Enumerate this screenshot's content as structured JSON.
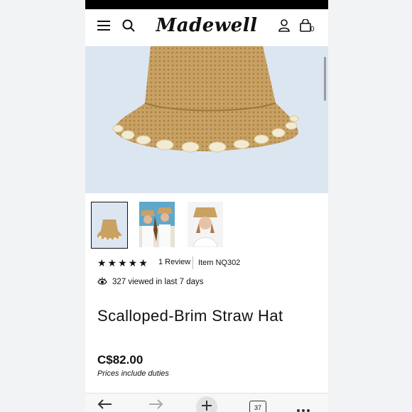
{
  "header": {
    "logo": "Madewell",
    "cart_count": "0",
    "icons": [
      "menu-icon",
      "search-icon",
      "account-icon",
      "shopping-bag-icon"
    ]
  },
  "gallery": {
    "thumbnails": [
      "product-flatlay",
      "two-models-wearing-hat",
      "model-wearing-hat"
    ],
    "selected_index": 0
  },
  "product": {
    "rating": 5,
    "stars": "★★★★★",
    "reviews": "1 Review",
    "item": "Item NQ302",
    "views": "327 viewed in last 7 days",
    "title": "Scalloped-Brim Straw Hat",
    "price": "C$82.00",
    "duties_note": "Prices include duties"
  },
  "browser": {
    "tab_count": "37",
    "icons": [
      "back-arrow-icon",
      "forward-arrow-icon",
      "new-tab-plus-icon",
      "tabs-icon",
      "more-icon"
    ]
  },
  "colors": {
    "straw": "#c9a163",
    "hero_background": "#dbe6f1",
    "text": "#111111"
  }
}
